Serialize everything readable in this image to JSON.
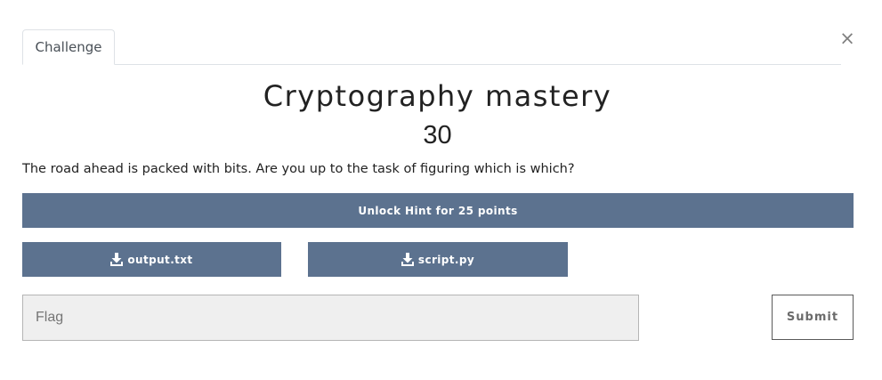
{
  "modal": {
    "close_glyph": "×",
    "tab_label": "Challenge",
    "title": "Cryptography mastery",
    "value": "30",
    "description": "The road ahead is packed with bits. Are you up to the task of figuring which is which?"
  },
  "buttons": {
    "hint": "Unlock Hint for 25 points",
    "files": [
      "output.txt",
      "script.py"
    ],
    "submit": "Submit"
  },
  "flag_input": {
    "placeholder": "Flag",
    "value": ""
  },
  "colors": {
    "button_bg": "#5c728f",
    "button_text": "#ffffff"
  },
  "icons": {
    "download": "download-icon",
    "close": "close-icon"
  }
}
